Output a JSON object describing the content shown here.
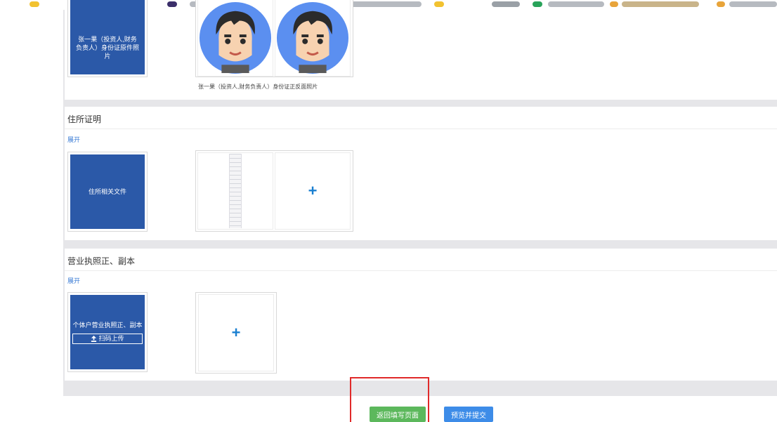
{
  "colors": {
    "accent": "#2b59a8",
    "link": "#3a7bd5",
    "plus": "#1a7fd0",
    "green_button": "#5cb85c",
    "blue_button": "#3d8ce8",
    "annotation": "#e02a2a"
  },
  "identity_section": {
    "sample_label": "张一果（投资人,财务负责人）身份证原件照片",
    "photo_caption": "张一果（投资人,财务负责人）身份证正反面照片",
    "slot_icons": [
      "avatar-icon",
      "avatar-icon"
    ]
  },
  "residence_section": {
    "title": "住所证明",
    "expand_label": "展开",
    "sample_label": "住所相关文件",
    "add_icon": "+"
  },
  "license_section": {
    "title": "营业执照正、副本",
    "expand_label": "展开",
    "sample_label": "个体户营业执照正、副本",
    "scan_upload_label": "扫码上传",
    "add_icon": "+"
  },
  "footer": {
    "back_button": "返回填写页面",
    "submit_button": "预览并提交"
  }
}
